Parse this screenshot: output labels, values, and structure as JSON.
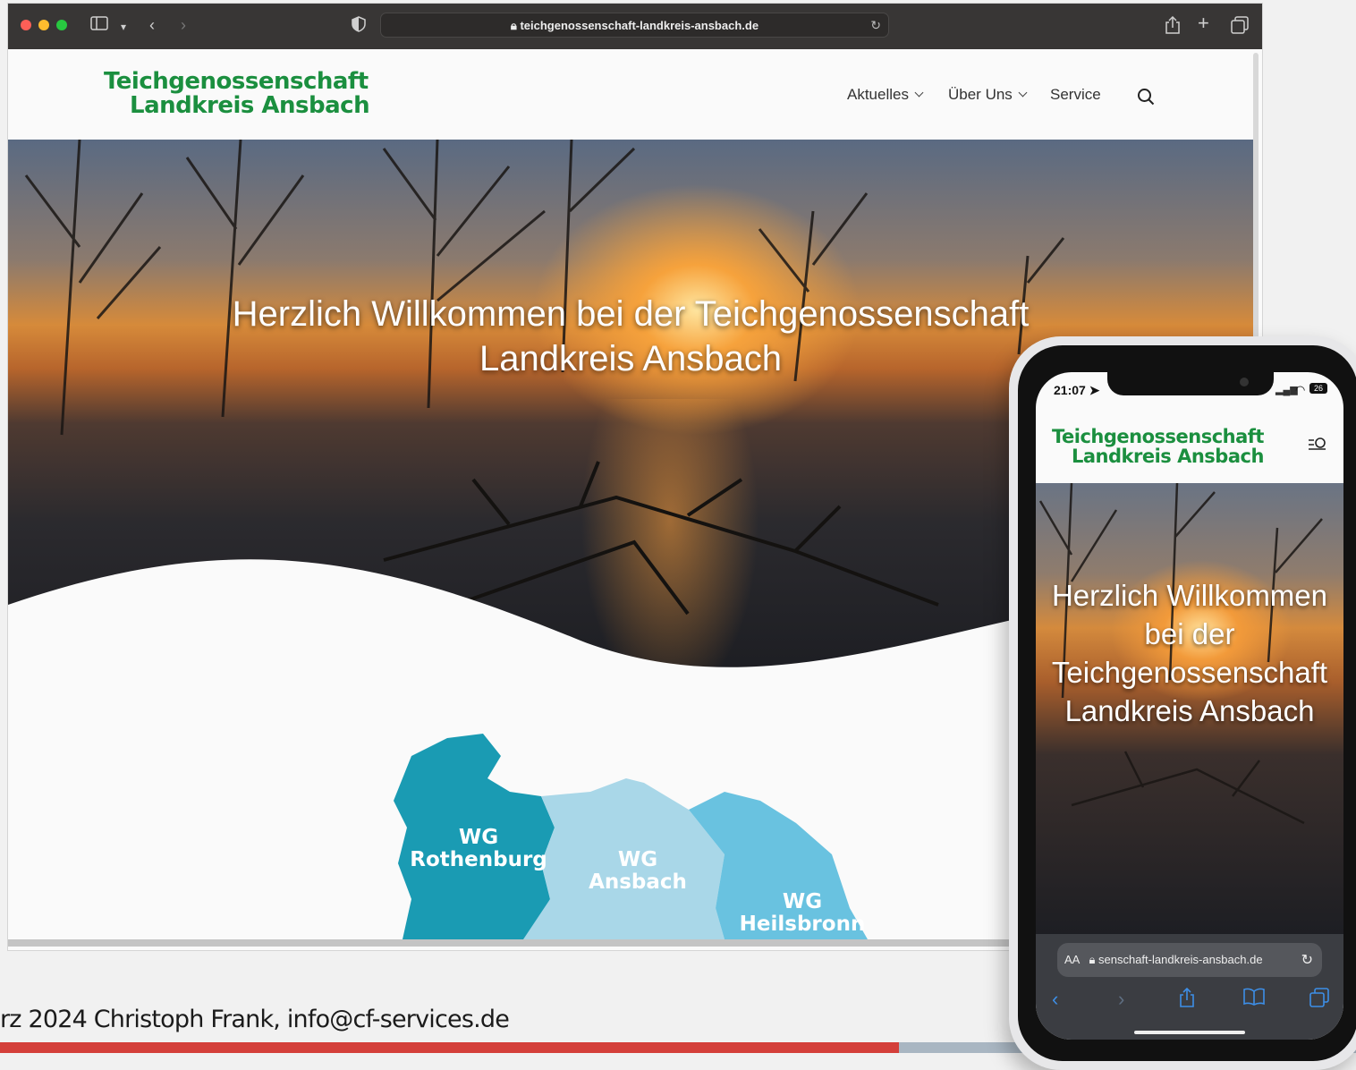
{
  "browser": {
    "url": "teichgenossenschaft-landkreis-ansbach.de"
  },
  "site": {
    "logo_line1": "Teichgenossenschaft",
    "logo_line2": "Landkreis Ansbach",
    "nav": [
      {
        "label": "Aktuelles",
        "has_dropdown": true
      },
      {
        "label": "Über Uns",
        "has_dropdown": true
      },
      {
        "label": "Service",
        "has_dropdown": false
      }
    ],
    "hero_line1": "Herzlich Willkommen bei der Teichgenossenschaft",
    "hero_line2": "Landkreis Ansbach",
    "map_regions": [
      {
        "line1": "WG",
        "line2": "Rothenburg",
        "color": "#1a9bb3"
      },
      {
        "line1": "WG",
        "line2": "Ansbach",
        "color": "#a9d7e8"
      },
      {
        "line1": "WG",
        "line2": "Heilsbronn",
        "color": "#69c2e0"
      }
    ]
  },
  "footer": {
    "text": "rz 2024 Christoph Frank, info@cf-services.de"
  },
  "phone": {
    "time": "21:07",
    "battery": "26",
    "logo_line1": "Teichgenossenschaft",
    "logo_line2": "Landkreis Ansbach",
    "hero_lines": [
      "Herzlich Willkommen",
      "bei der",
      "Teichgenossenschaft",
      "Landkreis Ansbach"
    ],
    "text_size_label": "AA",
    "url": "senschaft-landkreis-ansbach.de"
  },
  "colors": {
    "brand_green": "#1b8f3f",
    "footer_red": "#d43f3a",
    "ios_blue": "#3d8fe8"
  }
}
